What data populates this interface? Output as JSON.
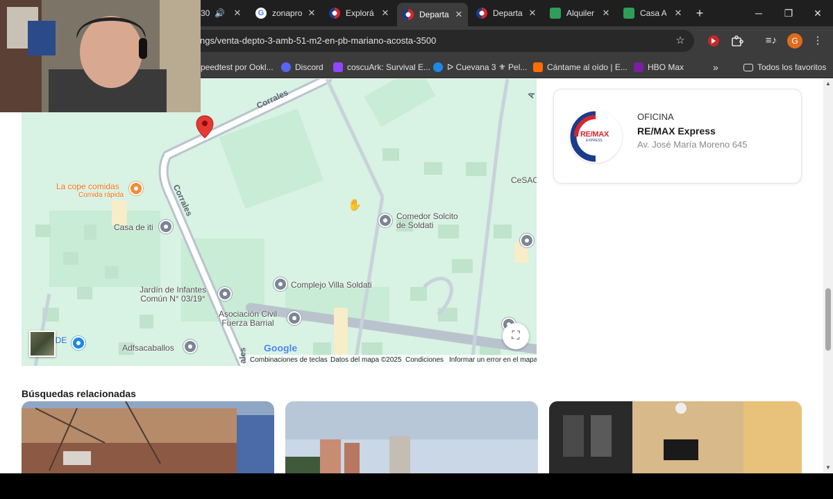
{
  "tabs": [
    {
      "title": "30",
      "icon": "speaker-icon",
      "active": false
    },
    {
      "title": "zonapro",
      "icon": "google-icon",
      "active": false
    },
    {
      "title": "Explorá",
      "icon": "remax-icon",
      "active": false
    },
    {
      "title": "Departa",
      "icon": "remax-icon",
      "active": true
    },
    {
      "title": "Departa",
      "icon": "remax-icon",
      "active": false
    },
    {
      "title": "Alquiler",
      "icon": "listing-site-icon",
      "active": false
    },
    {
      "title": "Casa Al",
      "icon": "listing-site-icon",
      "active": false
    }
  ],
  "toolbar": {
    "url": "ngs/venta-depto-3-amb-51-m2-en-pb-mariano-acosta-3500",
    "profile_initial": "G"
  },
  "bookmarks": [
    {
      "label": "peedtest por Ookl...",
      "color": "#9aa0a6"
    },
    {
      "label": "Discord",
      "color": "#5865f2"
    },
    {
      "label": "coscuArk: Survival E...",
      "color": "#9146ff"
    },
    {
      "label": "ᐅ Cuevana 3 ⚜ Pel...",
      "color": "#1e88e5"
    },
    {
      "label": "Cántame al oído | E...",
      "color": "#ff6d00"
    },
    {
      "label": "HBO Max",
      "color": "#7b1fa2"
    }
  ],
  "bookmarks_all_label": "Todos los favoritos",
  "map": {
    "streets": [
      "Corrales",
      "Corrales",
      "ales",
      "A"
    ],
    "places": [
      {
        "name": "La cope comidas",
        "sub": "Comida rápida"
      },
      {
        "name": "Casa de iti"
      },
      {
        "name": "Comedor Solcito\nde Soldati"
      },
      {
        "name": "CeSAC"
      },
      {
        "name": "Complejo Villa Soldati"
      },
      {
        "name": "Jardín de Infantes\nComún N° 03/19°"
      },
      {
        "name": "Asociación Civil\nFuerza Barrial"
      },
      {
        "name": "Adfsacaballos"
      },
      {
        "name": "CH DE\nOS"
      }
    ],
    "brand": "Google",
    "footer": [
      "Combinaciones de teclas",
      "Datos del mapa ©2025",
      "Condiciones",
      "Informar un error en el mapa"
    ]
  },
  "office": {
    "label": "OFICINA",
    "name": "RE/MAX Express",
    "address": "Av. José María Moreno 645",
    "logo_text": "RE/MAX",
    "logo_sub": "EXPRESS"
  },
  "related": {
    "title": "Búsquedas relacionadas"
  },
  "colors": {
    "map_bg": "#d8f2e3",
    "remax_red": "#d7262e",
    "remax_blue": "#1a3c8c",
    "pin_red": "#e53935"
  }
}
